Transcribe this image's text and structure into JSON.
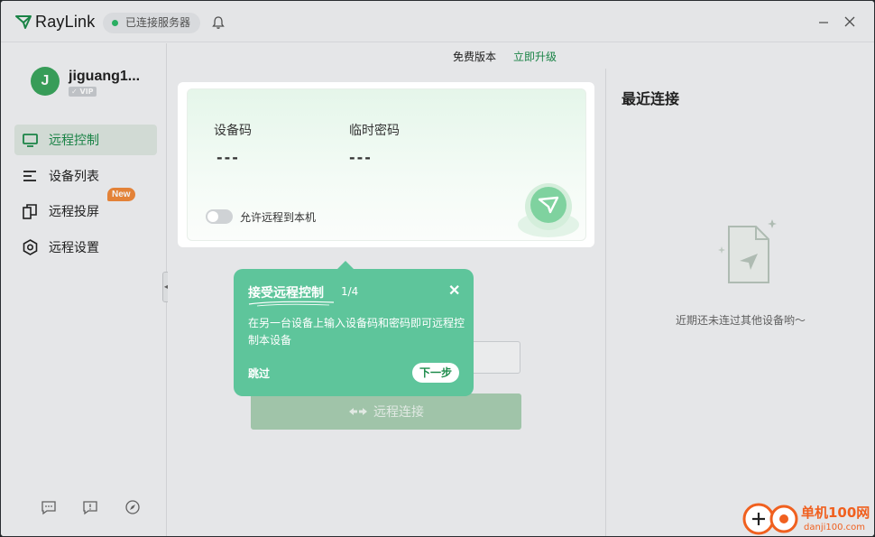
{
  "app": {
    "name": "RayLink",
    "server_status": "已连接服务器"
  },
  "colors": {
    "brand_green": "#1c8b4a",
    "tooltip_green": "#5ec59b",
    "status_green": "#2db868",
    "new_badge": "#f08a3c"
  },
  "user": {
    "initial": "J",
    "name": "jiguang1...",
    "vip_label": "VIP"
  },
  "sidebar": {
    "items": [
      {
        "label": "远程控制",
        "icon": "monitor-icon",
        "active": true
      },
      {
        "label": "设备列表",
        "icon": "list-icon",
        "active": false
      },
      {
        "label": "远程投屏",
        "icon": "screen-cast-icon",
        "active": false
      },
      {
        "label": "远程设置",
        "icon": "settings-hex-icon",
        "active": false
      }
    ],
    "new_badge": "New",
    "footer_icons": [
      "chat-icon",
      "feedback-icon",
      "compass-icon"
    ]
  },
  "upgrade_bar": {
    "version_label": "免费版本",
    "upgrade_link": "立即升级"
  },
  "device_card": {
    "device_code_label": "设备码",
    "device_code_value": "---",
    "temp_password_label": "临时密码",
    "temp_password_value": "---",
    "allow_remote_label": "允许远程到本机",
    "allow_remote_on": false
  },
  "connect": {
    "button_label": "远程连接"
  },
  "recent": {
    "title": "最近连接",
    "empty_text": "近期还未连过其他设备哟～"
  },
  "tooltip": {
    "title": "接受远程控制",
    "step": "1/4",
    "body": "在另一台设备上输入设备码和密码即可远程控制本设备",
    "skip_label": "跳过",
    "next_label": "下一步"
  },
  "watermark": {
    "text": "单机100网",
    "sub": "danji100.com"
  }
}
